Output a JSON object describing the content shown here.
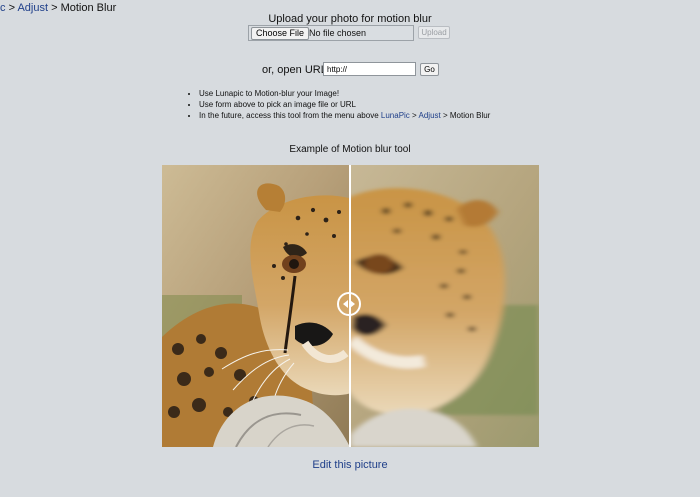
{
  "breadcrumb": {
    "items": [
      {
        "label": "c",
        "link": true
      },
      {
        "separator": ">"
      },
      {
        "label": "Adjust",
        "link": true
      },
      {
        "separator": ">"
      },
      {
        "label": "Motion Blur",
        "link": false
      }
    ]
  },
  "upload": {
    "title": "Upload your photo for motion blur",
    "choose_file_label": "Choose File",
    "file_status": "No file chosen",
    "upload_label": "Upload"
  },
  "url": {
    "label": "or, open URL",
    "value": "http://",
    "go_label": "Go"
  },
  "tips": [
    "Use Lunapic to Motion-blur your Image!",
    "Use form above to pick an image file or URL",
    "In the future, access this tool from the menu above"
  ],
  "tip_path": {
    "lunapic": "LunaPic",
    "sep1": ">",
    "adjust": "Adjust",
    "sep2": ">",
    "current": "Motion Blur"
  },
  "example": {
    "title": "Example of Motion blur tool",
    "image_subject": "cheetah",
    "divider_color": "#ffffff",
    "icon": "compare-handle-icon"
  },
  "edit_link": "Edit this picture",
  "colors": {
    "background": "#d7dbdf",
    "link": "#20408a"
  }
}
